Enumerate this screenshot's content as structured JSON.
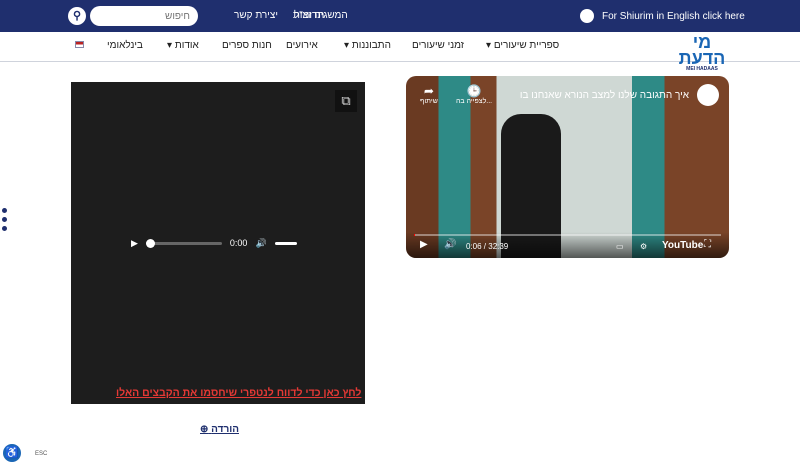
{
  "topbar": {
    "english_link": "For Shiurim in English click here",
    "links": [
      "המשגיח זצ\"ל",
      "תרומות",
      "יצירת קשר"
    ],
    "search_placeholder": "חיפוש"
  },
  "logo": {
    "text": "מי הדעת",
    "sub": "MEI HADAAS"
  },
  "nav": {
    "items": [
      "ספריית שיעורים",
      "זמני שיעורים",
      "התבוננות",
      "אירועים",
      "חנות ספרים",
      "אודות",
      "בינלאומי"
    ]
  },
  "audio": {
    "time": "0:00",
    "report_link": "לחץ כאן כדי לדווח לנטפרי שיחסמו את הקבצים האלו",
    "download": "הורדה"
  },
  "video": {
    "title": "איך התגובה שלנו למצב הנורא שאנחנו בו",
    "watch_later": "לצפייה בה...",
    "share": "שיתוף",
    "time": "0:06 / 32:39",
    "progress": 0.003,
    "brand": "YouTube"
  },
  "accessibility": {
    "esc": "ESC"
  }
}
